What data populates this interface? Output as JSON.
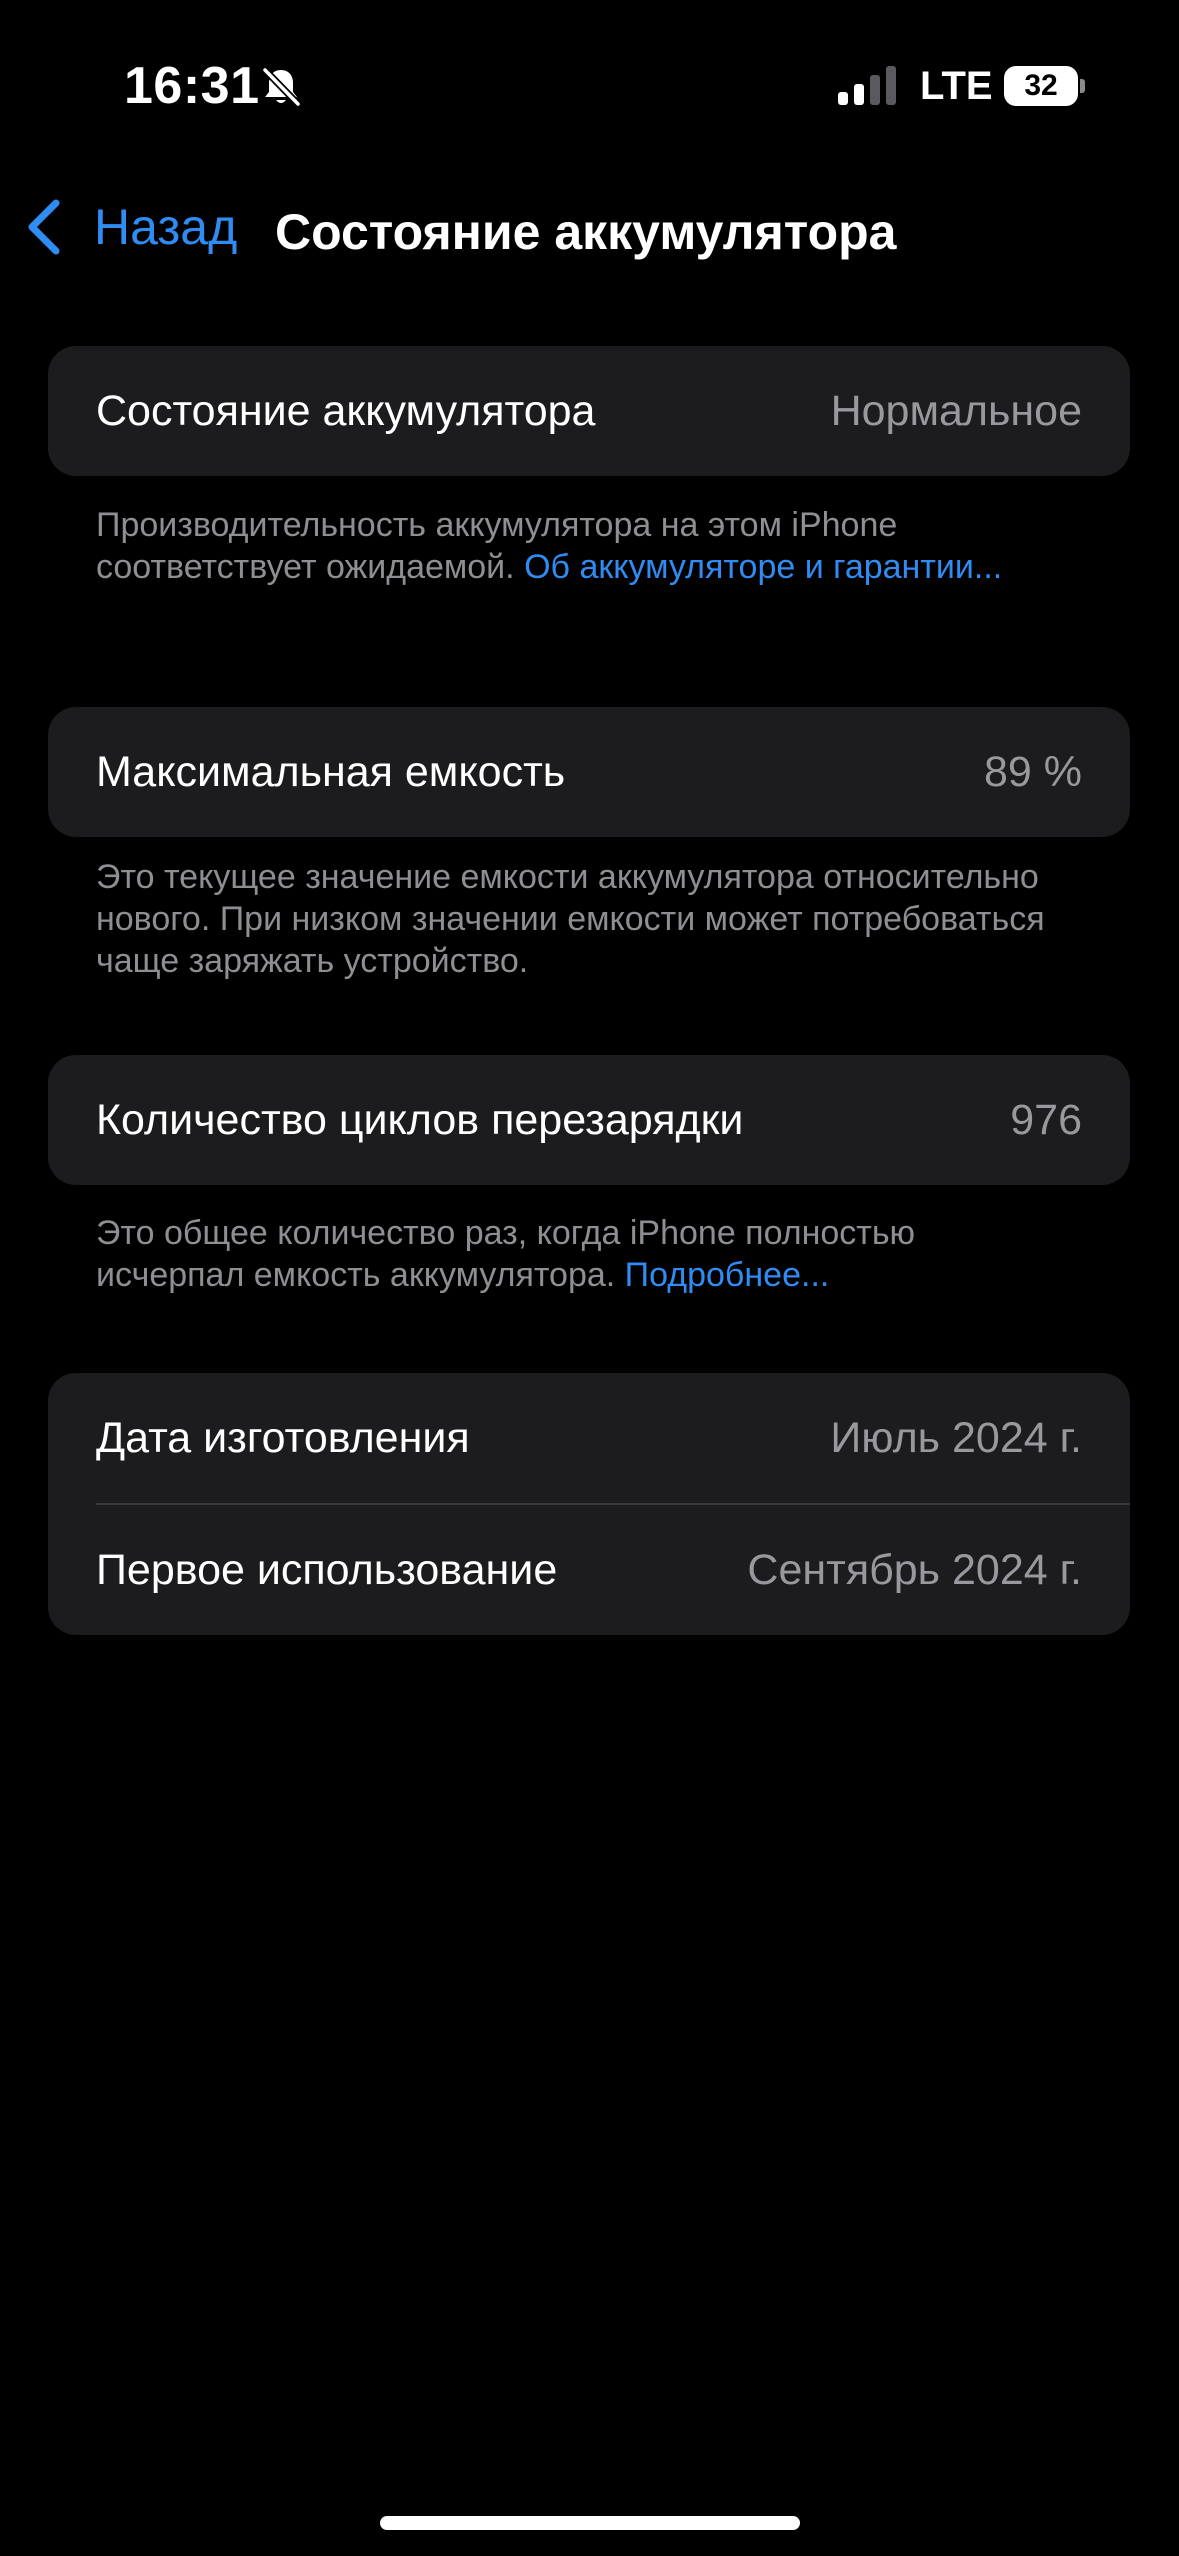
{
  "status_bar": {
    "time": "16:31",
    "silent_icon": "bell-slash-icon",
    "network": "LTE",
    "battery_level": "32",
    "signal_bars_active": 2,
    "signal_bars_total": 4
  },
  "nav": {
    "back_label": "Назад",
    "back_icon": "chevron-left-icon",
    "title": "Состояние аккумулятора"
  },
  "battery_condition": {
    "label": "Состояние аккумулятора",
    "value": "Нормальное",
    "footnote_text": "Производительность аккумулятора на этом iPhone соответствует ожидаемой. ",
    "footnote_link": "Об аккумуляторе и гарантии..."
  },
  "max_capacity": {
    "label": "Максимальная емкость",
    "value": "89 %",
    "footnote_text": "Это текущее значение емкости аккумулятора относительно нового. При низком значении емкости может потребоваться чаще заряжать устройство."
  },
  "cycle_count": {
    "label": "Количество циклов перезарядки",
    "value": "976",
    "footnote_text": "Это общее количество раз, когда iPhone полностью исчерпал емкость аккумулятора. ",
    "footnote_link": "Подробнее..."
  },
  "dates": {
    "manufacture_label": "Дата изготовления",
    "manufacture_value": "Июль 2024 г.",
    "first_use_label": "Первое использование",
    "first_use_value": "Сентябрь 2024 г."
  },
  "colors": {
    "background": "#000000",
    "card": "#1c1c1e",
    "accent": "#2f8cf3",
    "secondary_text": "#98989e"
  }
}
